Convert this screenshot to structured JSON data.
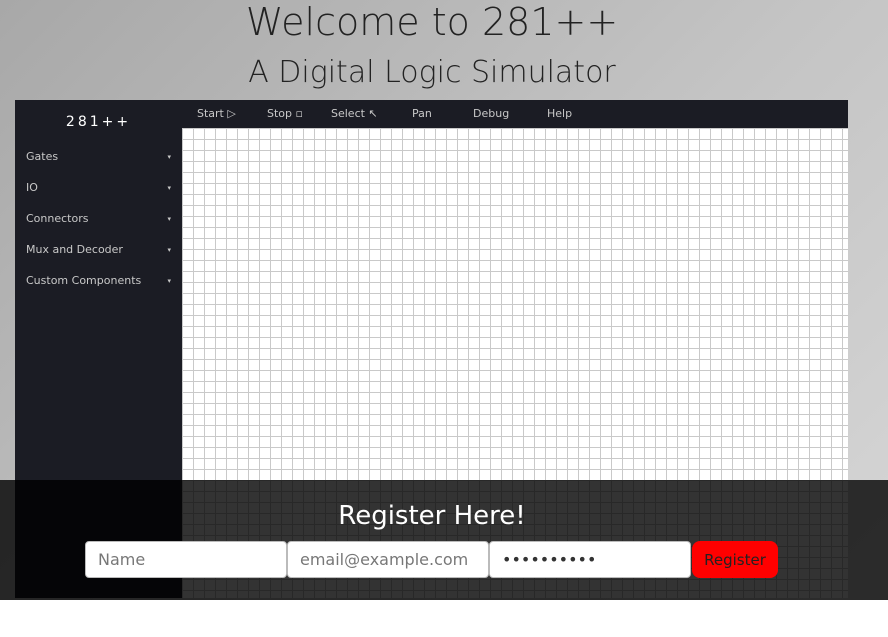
{
  "hero": {
    "title": "Welcome to 281++",
    "subtitle": "A Digital Logic Simulator"
  },
  "app": {
    "logo": "281++",
    "sidebar": {
      "items": [
        {
          "label": "Gates",
          "caret": "▾"
        },
        {
          "label": "IO",
          "caret": "▾"
        },
        {
          "label": "Connectors",
          "caret": "▾"
        },
        {
          "label": "Mux and Decoder",
          "caret": "▾"
        },
        {
          "label": "Custom Components",
          "caret": "▾"
        }
      ]
    },
    "menu": {
      "start": "Start ▷",
      "stop": "Stop ▫",
      "select": "Select ↖",
      "pan": "Pan",
      "debug": "Debug",
      "help": "Help"
    }
  },
  "register": {
    "title": "Register Here!",
    "name_placeholder": "Name",
    "email_placeholder": "email@example.com",
    "password_value": "..........",
    "button_label": "Register",
    "button_color": "#ff0000"
  },
  "colors": {
    "app_dark": "#1b1c24",
    "overlay": "#000000"
  }
}
